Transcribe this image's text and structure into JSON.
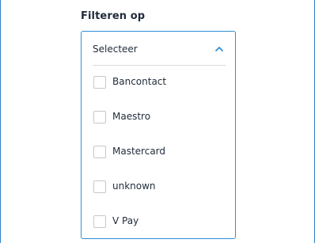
{
  "filter": {
    "label": "Filteren op"
  },
  "dropdown": {
    "selected_value": "Selecteer",
    "state_icon": "chevron-up-icon",
    "accent_color": "#2f8fd6",
    "options": [
      {
        "label": "Bancontact",
        "checked": false
      },
      {
        "label": "Maestro",
        "checked": false
      },
      {
        "label": "Mastercard",
        "checked": false
      },
      {
        "label": "unknown",
        "checked": false
      },
      {
        "label": "V Pay",
        "checked": false
      }
    ]
  }
}
